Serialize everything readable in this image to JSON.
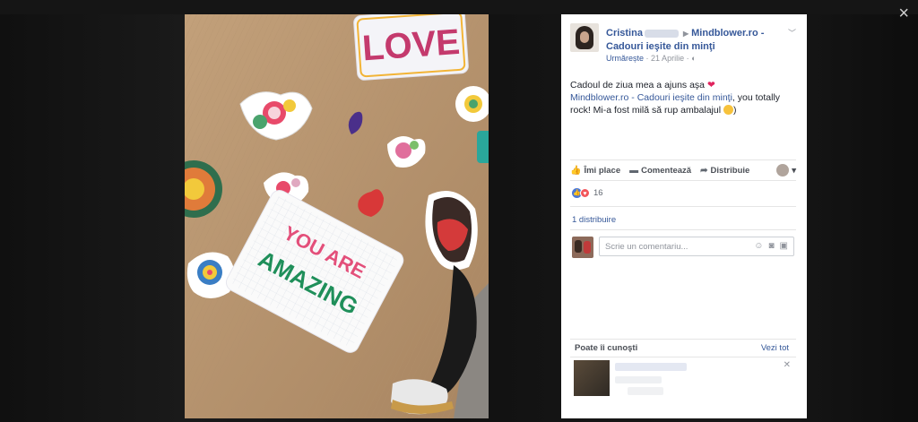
{
  "viewer": {
    "close_label": "×"
  },
  "post": {
    "author_first": "Cristina",
    "page_name_line1": "Mindblower.ro -",
    "page_name_line2": "Cadouri ieşite din minţi",
    "follow_label": "Urmărește",
    "date": "21 Aprilie",
    "text_line1": "Cadoul de ziua mea a ajuns aşa",
    "text_link": "Mindblower.ro - Cadouri ieşite din minţi",
    "text_after_link": ", you totally",
    "text_line3": "rock! Mi-a fost milă să rup ambalajul",
    "text_end": ")"
  },
  "actions": {
    "like": "Îmi place",
    "comment": "Comentează",
    "share": "Distribuie"
  },
  "reactions": {
    "count": "16"
  },
  "shares": {
    "label": "1 distribuire"
  },
  "comment_box": {
    "placeholder": "Scrie un comentariu..."
  },
  "pymk": {
    "title": "Poate îi cunoşti",
    "see_all": "Vezi tot"
  },
  "colors": {
    "link": "#365899",
    "like": "#4c78d6",
    "love": "#f2555a",
    "heart": "#e0245e"
  },
  "icons": [
    "close-icon",
    "caret-down-icon",
    "globe-icon",
    "like-icon",
    "comment-icon",
    "share-icon",
    "emoji-icon",
    "camera-icon",
    "sticker-icon"
  ]
}
